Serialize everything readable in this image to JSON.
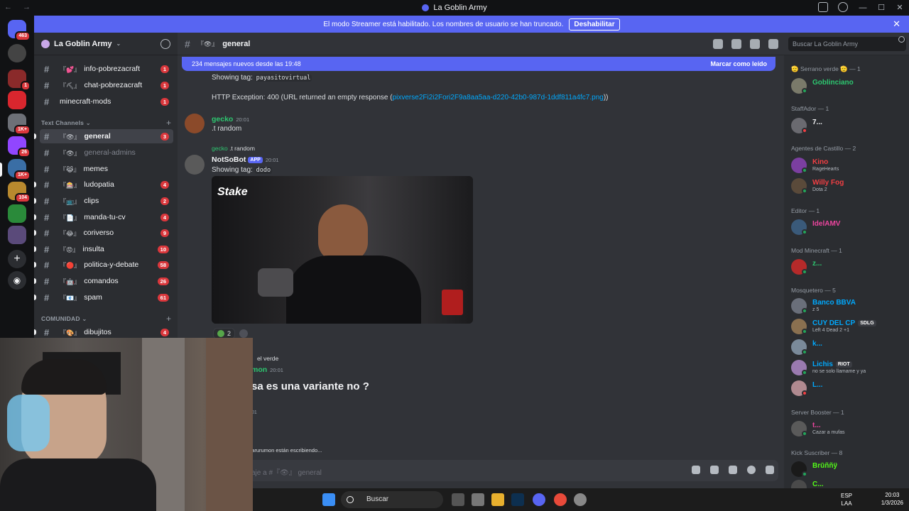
{
  "window": {
    "title": "La Goblin Army"
  },
  "streamer_banner": {
    "text": "El modo Streamer está habilitado. Los nombres de usuario se han truncado.",
    "button": "Deshabilitar"
  },
  "guild_badges": [
    "463",
    "1",
    "1K+",
    "26",
    "1K+",
    "104"
  ],
  "server": {
    "name": "La Goblin Army"
  },
  "channels_top": [
    {
      "emoji": "『💕』",
      "name": "info-pobrezacraft",
      "badge": "1"
    },
    {
      "emoji": "『⛏』",
      "name": "chat-pobrezacraft",
      "badge": "1"
    },
    {
      "emoji": "",
      "name": "minecraft-mods",
      "badge": "1"
    }
  ],
  "categories": {
    "text": "Text Channels",
    "community": "COMUNIDAD"
  },
  "channels": [
    {
      "emoji": "『👁』",
      "name": "general",
      "badge": "3"
    },
    {
      "emoji": "『👁』",
      "name": "general-admins",
      "badge": ""
    },
    {
      "emoji": "『😹』",
      "name": "memes",
      "badge": ""
    },
    {
      "emoji": "『🎰』",
      "name": "ludopatia",
      "badge": "4"
    },
    {
      "emoji": "『📺』",
      "name": "clips",
      "badge": "2"
    },
    {
      "emoji": "『📄』",
      "name": "manda-tu-cv",
      "badge": "4"
    },
    {
      "emoji": "『😂』",
      "name": "coriverso",
      "badge": "9"
    },
    {
      "emoji": "『😡』",
      "name": "insulta",
      "badge": "10"
    },
    {
      "emoji": "『🔴』",
      "name": "politica-y-debate",
      "badge": "58"
    },
    {
      "emoji": "『🤖』",
      "name": "comandos",
      "badge": "26"
    },
    {
      "emoji": "『📧』",
      "name": "spam",
      "badge": "61"
    }
  ],
  "channels_community": [
    {
      "emoji": "『🎨』",
      "name": "dibujitos",
      "badge": "4"
    }
  ],
  "chat_header": {
    "emoji": "『👁』",
    "channel": "general"
  },
  "search": {
    "placeholder": "Buscar La Goblin Army"
  },
  "new_messages": {
    "text": "234 mensajes nuevos desde las 19:48",
    "mark": "Marcar como leído"
  },
  "messages": {
    "m1_tag_label": "Showing tag:",
    "m1_tag": "payasitovirtual",
    "m1_error": "HTTP Exception: 400 (URL returned an empty response (",
    "m1_link": "pixverse2Fi2i2Fori2F9a8aa5aa-d220-42b0-987d-1ddf811a4fc7.png",
    "m1_close": "))",
    "m2_user": "gecko",
    "m2_time": "20:01",
    "m2_text": ".t random",
    "m3_reply_user": "gecko",
    "m3_reply_text": ".t random",
    "m3_user": "NotSoBot",
    "m3_app": "APP",
    "m3_time": "20:01",
    "m3_tag_label": "Showing tag:",
    "m3_tag": "dodo",
    "m3_embed_brand": "Stake",
    "m3_react_count": "2",
    "m4_reply": "el verde",
    "m4_user": "mon",
    "m4_time": "20:01",
    "m4_text": "sa es una variante no ?",
    "m5_time": "01",
    "typing": "garurumon están escribiendo..."
  },
  "composer": {
    "placeholder": "aje a #『👁』 general"
  },
  "members": {
    "roles": [
      {
        "label": "🫡 Serrano verde 🫡 — 1"
      },
      {
        "label": "StaffAdor — 1"
      },
      {
        "label": "Agentes de Castillo — 2"
      },
      {
        "label": "Editor — 1"
      },
      {
        "label": "Mod Minecraft — 1"
      },
      {
        "label": "Mosquetero — 5"
      },
      {
        "label": "Server Booster — 1"
      },
      {
        "label": "Kick Suscriber — 8"
      }
    ],
    "list": [
      {
        "name": "Goblinciano",
        "sub": "",
        "tag": ""
      },
      {
        "name": "7...",
        "sub": "",
        "tag": ""
      },
      {
        "name": "Kino",
        "sub": "RageHearts",
        "tag": ""
      },
      {
        "name": "Willy Fog",
        "sub": "Dota 2",
        "tag": ""
      },
      {
        "name": "IdelAMV",
        "sub": "",
        "tag": ""
      },
      {
        "name": "z...",
        "sub": "",
        "tag": ""
      },
      {
        "name": "Banco BBVA",
        "sub": "z 5",
        "tag": ""
      },
      {
        "name": "CUY DEL CP",
        "sub": "Left 4 Dead 2 +1",
        "tag": "SDLG"
      },
      {
        "name": "k...",
        "sub": "",
        "tag": ""
      },
      {
        "name": "Lichis",
        "sub": "no se solo llamame y ya",
        "tag": "RIOT"
      },
      {
        "name": "L...",
        "sub": "",
        "tag": ""
      },
      {
        "name": "t...",
        "sub": "Cazar a mufas",
        "tag": ""
      },
      {
        "name": "Brūññÿ",
        "sub": "",
        "tag": ""
      },
      {
        "name": "C...",
        "sub": "",
        "tag": ""
      }
    ]
  },
  "taskbar": {
    "search": "Buscar",
    "lang": "ESP",
    "lang2": "LAA",
    "time": "20:03",
    "date": "1/3/2026"
  },
  "colors": {
    "blurple": "#5865f2",
    "green_name": "#2dc770",
    "red_name": "#f23f43",
    "blue_name": "#00a8fc",
    "pink_name": "#eb459e"
  }
}
